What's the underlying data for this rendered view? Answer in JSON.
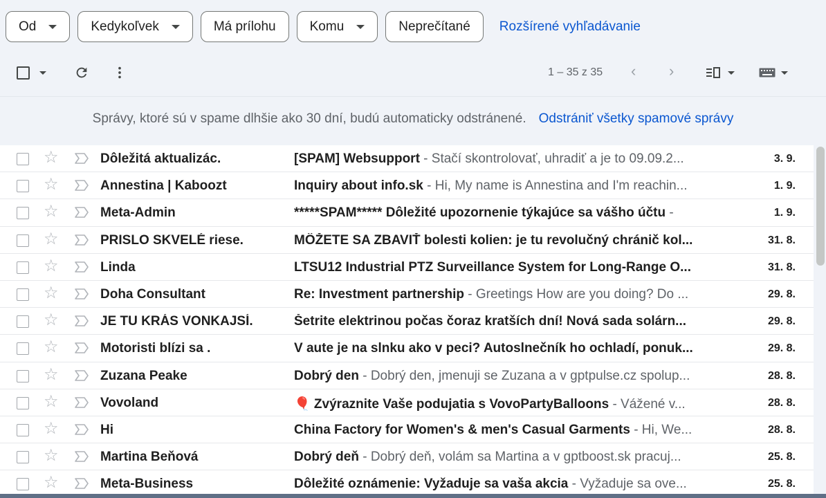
{
  "filters": {
    "chips": [
      {
        "label": "Od",
        "dropdown": true
      },
      {
        "label": "Kedykoľvek",
        "dropdown": true
      },
      {
        "label": "Má prílohu",
        "dropdown": false
      },
      {
        "label": "Komu",
        "dropdown": true
      },
      {
        "label": "Neprečítané",
        "dropdown": false
      }
    ],
    "advanced_search": "Rozšírené vyhľadávanie"
  },
  "toolbar": {
    "pagination": "1 – 35 z 35",
    "icons": [
      "select-all-checkbox",
      "refresh-icon",
      "more-vert-icon",
      "chevron-left-icon",
      "chevron-right-icon",
      "split-pane-icon",
      "keyboard-icon"
    ]
  },
  "banner": {
    "text": "Správy, ktoré sú v spame dlhšie ako 30 dní, budú automaticky odstránené.",
    "action": "Odstrániť všetky spamové správy"
  },
  "colors": {
    "accent": "#0b57d0",
    "background": "#f0f3f8"
  },
  "emails": [
    {
      "sender": "Dôležitá aktualizác.",
      "subject": "[SPAM] Websupport",
      "snippet": " - Stačí skontrolovať, uhradiť a je to 09.09.2...",
      "date": "3. 9."
    },
    {
      "sender": "Annestina | Kaboozt",
      "subject": "Inquiry about info.sk",
      "snippet": " - Hi, My name is Annestina and I'm reachin...",
      "date": "1. 9."
    },
    {
      "sender": "Meta-Admin",
      "subject": "*****SPAM***** Dôležité upozornenie týkajúce sa vášho účtu",
      "snippet": " -",
      "date": "1. 9."
    },
    {
      "sender": "PRISLO SKVELÉ riese.",
      "subject": "MÔŽETE SA ZBAVIŤ bolesti kolien: je tu revolučný chránič kol...",
      "snippet": "",
      "date": "31. 8."
    },
    {
      "sender": "Linda",
      "subject": "LTSU12 Industrial PTZ Surveillance System for Long-Range O...",
      "snippet": "",
      "date": "31. 8."
    },
    {
      "sender": "Doha Consultant",
      "subject": "Re: Investment partnership",
      "snippet": " - Greetings How are you doing? Do ...",
      "date": "29. 8."
    },
    {
      "sender": "JE TU KRÁS VONKAJSÍ.",
      "subject": "Šetrite elektrinou počas čoraz kratších dní! Nová sada solárn...",
      "snippet": "",
      "date": "29. 8."
    },
    {
      "sender": "Motoristi blízi sa .",
      "subject": "V aute je na slnku ako v peci? Autoslnečník ho ochladí, ponuk...",
      "snippet": "",
      "date": "29. 8."
    },
    {
      "sender": "Zuzana Peake",
      "subject": "Dobrý den",
      "snippet": " - Dobrý den, jmenuji se Zuzana a v gptpulse.cz spolup...",
      "date": "28. 8."
    },
    {
      "sender": "Vovoland",
      "subject": "🎈 Zvýraznite Vaše podujatia s VovoPartyBalloons",
      "snippet": " - Vážené v...",
      "date": "28. 8."
    },
    {
      "sender": "Hi",
      "subject": "China Factory for Women's & men's Casual Garments",
      "snippet": " - Hi, We...",
      "date": "28. 8."
    },
    {
      "sender": "Martina Beňová",
      "subject": "Dobrý deň",
      "snippet": " - Dobrý deň, volám sa Martina a v gptboost.sk pracuj...",
      "date": "25. 8."
    },
    {
      "sender": "Meta-Business",
      "subject": "Dôležité oznámenie: Vyžaduje sa vaša akcia",
      "snippet": " - Vyžaduje sa ove...",
      "date": "25. 8."
    }
  ]
}
